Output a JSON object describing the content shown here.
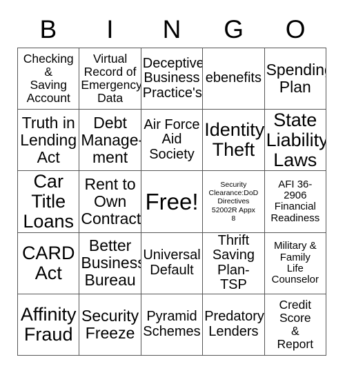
{
  "card": {
    "header_letters": [
      "B",
      "I",
      "N",
      "G",
      "O"
    ],
    "grid_size": "5x5",
    "border_color": "#555555",
    "background_color": "#ffffff",
    "text_color": "#000000",
    "cells": [
      {
        "text": "Checking\n&\nSaving\nAccount",
        "size": "sm",
        "column": "B",
        "row": 1
      },
      {
        "text": "Virtual\nRecord of\nEmergency\nData",
        "size": "sm",
        "column": "I",
        "row": 1
      },
      {
        "text": "Deceptive\nBusiness\nPractice's",
        "size": "md",
        "column": "N",
        "row": 1
      },
      {
        "text": "ebenefits",
        "size": "md",
        "column": "G",
        "row": 1
      },
      {
        "text": "Spending\nPlan",
        "size": "lg",
        "column": "O",
        "row": 1
      },
      {
        "text": "Truth in\nLending\nAct",
        "size": "lg",
        "column": "B",
        "row": 2
      },
      {
        "text": "Debt\nManage-\nment",
        "size": "lg",
        "column": "I",
        "row": 2
      },
      {
        "text": "Air Force\nAid\nSociety",
        "size": "md",
        "column": "N",
        "row": 2
      },
      {
        "text": "Identity\nTheft",
        "size": "xl",
        "column": "G",
        "row": 2
      },
      {
        "text": "State\nLiability\nLaws",
        "size": "xl",
        "column": "O",
        "row": 2
      },
      {
        "text": "Car\nTitle\nLoans",
        "size": "xl",
        "column": "B",
        "row": 3
      },
      {
        "text": "Rent to\nOwn\nContract",
        "size": "lg",
        "column": "I",
        "row": 3
      },
      {
        "text": "Free!",
        "size": "free",
        "column": "N",
        "row": 3
      },
      {
        "text": "Security\nClearance:DoD\nDirectives\n52002R Appx\n8",
        "size": "tiny",
        "column": "G",
        "row": 3
      },
      {
        "text": "AFI 36-\n2906\nFinancial\nReadiness",
        "size": "xs",
        "column": "O",
        "row": 3
      },
      {
        "text": "CARD\nAct",
        "size": "xl",
        "column": "B",
        "row": 4
      },
      {
        "text": "Better\nBusiness\nBureau",
        "size": "lg",
        "column": "I",
        "row": 4
      },
      {
        "text": "Universal\nDefault",
        "size": "md",
        "column": "N",
        "row": 4
      },
      {
        "text": "Thrift\nSaving\nPlan-TSP",
        "size": "md",
        "column": "G",
        "row": 4
      },
      {
        "text": "Military &\nFamily\nLife\nCounselor",
        "size": "xs",
        "column": "O",
        "row": 4
      },
      {
        "text": "Affinity\nFraud",
        "size": "xl",
        "column": "B",
        "row": 5
      },
      {
        "text": "Security\nFreeze",
        "size": "lg",
        "column": "I",
        "row": 5
      },
      {
        "text": "Pyramid\nSchemes",
        "size": "md",
        "column": "N",
        "row": 5
      },
      {
        "text": "Predatory\nLenders",
        "size": "md",
        "column": "G",
        "row": 5
      },
      {
        "text": "Credit\nScore\n&\nReport",
        "size": "sm",
        "column": "O",
        "row": 5
      }
    ]
  }
}
